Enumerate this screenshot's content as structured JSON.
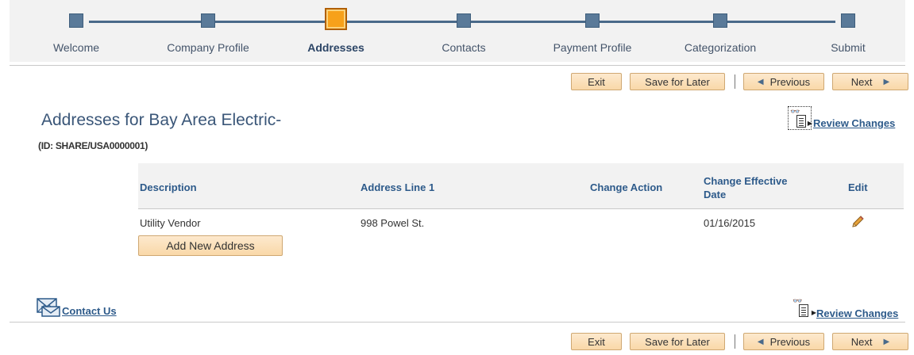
{
  "train": {
    "steps": [
      {
        "label": "Welcome"
      },
      {
        "label": "Company Profile"
      },
      {
        "label": "Addresses",
        "current": true
      },
      {
        "label": "Contacts"
      },
      {
        "label": "Payment Profile"
      },
      {
        "label": "Categorization"
      },
      {
        "label": "Submit"
      }
    ]
  },
  "buttons": {
    "exit": "Exit",
    "save": "Save for Later",
    "previous": "Previous",
    "next": "Next"
  },
  "page": {
    "title": "Addresses for Bay Area Electric-",
    "id_label": "(ID: SHARE/USA0000001)",
    "review_changes": "Review Changes"
  },
  "grid": {
    "headers": {
      "description": "Description",
      "address_line_1": "Address Line 1",
      "change_action": "Change Action",
      "change_effective_date": "Change Effective Date",
      "edit": "Edit"
    },
    "rows": [
      {
        "description": "Utility Vendor",
        "address_line_1": "998 Powel St.",
        "change_action": "",
        "change_effective_date": "01/16/2015",
        "edit_icon": "pencil-icon"
      }
    ],
    "add_button": "Add New Address"
  },
  "footer": {
    "contact_us": "Contact Us",
    "review_changes": "Review Changes"
  },
  "colors": {
    "step": "#5a7a99",
    "current_step": "#f7a11a",
    "link": "#2d5a8a",
    "button_bg": "#f9d8a8"
  }
}
